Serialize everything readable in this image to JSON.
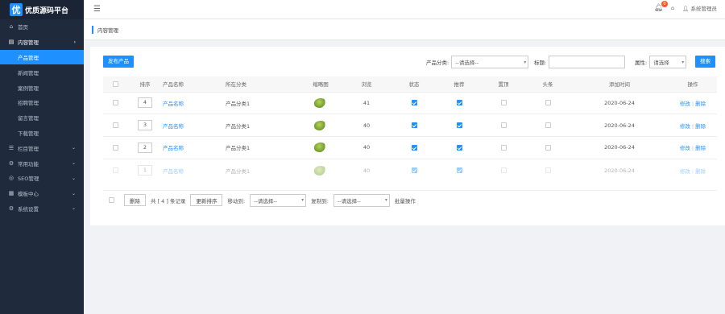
{
  "app": {
    "logo_char": "优",
    "title": "优质源码平台"
  },
  "header": {
    "menu_icon": "hamburger-icon",
    "notification_count": "0",
    "user_label": "系统管理员"
  },
  "sidebar": {
    "items": [
      {
        "label": "首页",
        "icon": "home-icon"
      },
      {
        "label": "内容管理",
        "icon": "content-icon",
        "expanded": true
      },
      {
        "label": "产品管理",
        "sub": true,
        "active": true
      },
      {
        "label": "新闻管理",
        "sub": true
      },
      {
        "label": "案例管理",
        "sub": true
      },
      {
        "label": "招聘管理",
        "sub": true
      },
      {
        "label": "留言管理",
        "sub": true
      },
      {
        "label": "下载管理",
        "sub": true
      },
      {
        "label": "栏目管理",
        "icon": "column-icon"
      },
      {
        "label": "常用功能",
        "icon": "tools-icon"
      },
      {
        "label": "SEO管理",
        "icon": "seo-icon"
      },
      {
        "label": "模板中心",
        "icon": "template-icon"
      },
      {
        "label": "系统设置",
        "icon": "settings-icon"
      }
    ]
  },
  "breadcrumb": "内容管理",
  "toolbar": {
    "publish_label": "发布产品",
    "category_label": "产品分类:",
    "category_value": "--请选择--",
    "title_label": "标题:",
    "title_value": "",
    "attr_label": "属性:",
    "attr_value": "请选择",
    "search_label": "搜索"
  },
  "table": {
    "headers": [
      "",
      "排序",
      "产品名称",
      "所在分类",
      "缩略图",
      "浏览",
      "状态",
      "推荐",
      "置顶",
      "头条",
      "添加时间",
      "操作"
    ],
    "edit_label": "修改",
    "delete_label": "删除",
    "rows": [
      {
        "sort": "4",
        "name": "产品名称",
        "category": "产品分类1",
        "views": "41",
        "status": true,
        "recommend": true,
        "top": false,
        "headline": false,
        "date": "2020-06-24"
      },
      {
        "sort": "3",
        "name": "产品名称",
        "category": "产品分类1",
        "views": "40",
        "status": true,
        "recommend": true,
        "top": false,
        "headline": false,
        "date": "2020-06-24"
      },
      {
        "sort": "2",
        "name": "产品名称",
        "category": "产品分类1",
        "views": "40",
        "status": true,
        "recommend": true,
        "top": false,
        "headline": false,
        "date": "2020-06-24"
      },
      {
        "sort": "1",
        "name": "产品名称",
        "category": "产品分类1",
        "views": "40",
        "status": true,
        "recommend": true,
        "top": false,
        "headline": false,
        "date": "2020-06-24"
      }
    ]
  },
  "footer": {
    "delete_label": "删除",
    "total_text": "共 [ 4 ] 条记录",
    "sort_label": "更新排序",
    "move_label": "移动到:",
    "move_value": "--请选择--",
    "copy_label": "复制到:",
    "copy_value": "--请选择--",
    "batch_label": "批量操作"
  },
  "colors": {
    "accent": "#1e90ff",
    "sidebar": "#1f2a3d"
  }
}
